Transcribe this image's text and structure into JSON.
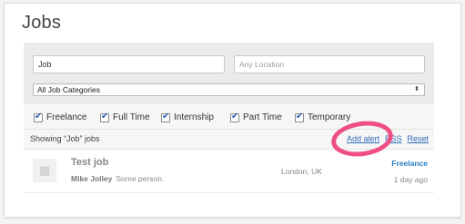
{
  "page": {
    "title": "Jobs"
  },
  "search": {
    "keywords_value": "Job",
    "location_placeholder": "Any Location",
    "category_selected": "All Job Categories"
  },
  "filters": [
    {
      "label": "Freelance",
      "checked": true
    },
    {
      "label": "Full Time",
      "checked": true
    },
    {
      "label": "Internship",
      "checked": true
    },
    {
      "label": "Part Time",
      "checked": true
    },
    {
      "label": "Temporary",
      "checked": true
    }
  ],
  "results": {
    "showing_prefix": "Showing “",
    "showing_keyword": "Job",
    "showing_suffix": "” jobs",
    "add_alert": "Add alert",
    "rss": "RSS",
    "reset": "Reset"
  },
  "jobs": [
    {
      "title": "Test job",
      "company": "Mike Jolley",
      "tagline": "Some person.",
      "location": "London, UK",
      "type": "Freelance",
      "posted": "1 day ago"
    }
  ],
  "colors": {
    "accent_link": "#2f6cb5",
    "job_type": "#2a7fc4",
    "highlight_ring": "#ef4f83"
  }
}
